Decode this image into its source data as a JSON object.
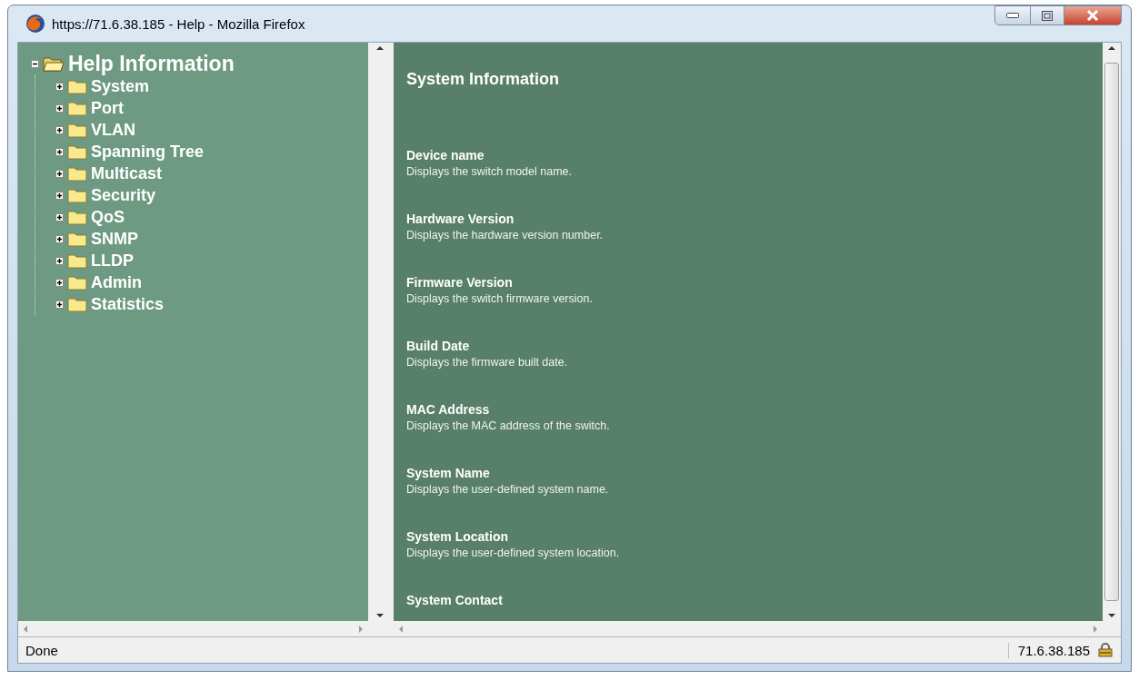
{
  "window": {
    "title": "https://71.6.38.185 - Help - Mozilla Firefox"
  },
  "tree": {
    "label": "Help Information",
    "expanded": true,
    "children": [
      {
        "label": "System",
        "expanded": false
      },
      {
        "label": "Port",
        "expanded": false
      },
      {
        "label": "VLAN",
        "expanded": false
      },
      {
        "label": "Spanning Tree",
        "expanded": false
      },
      {
        "label": "Multicast",
        "expanded": false
      },
      {
        "label": "Security",
        "expanded": false
      },
      {
        "label": "QoS",
        "expanded": false
      },
      {
        "label": "SNMP",
        "expanded": false
      },
      {
        "label": "LLDP",
        "expanded": false
      },
      {
        "label": "Admin",
        "expanded": false
      },
      {
        "label": "Statistics",
        "expanded": false
      }
    ]
  },
  "content": {
    "title": "System Information",
    "entries": [
      {
        "term": "Device name",
        "description": "Displays the switch model name."
      },
      {
        "term": "Hardware Version",
        "description": "Displays the hardware version number."
      },
      {
        "term": "Firmware Version",
        "description": "Displays the switch firmware version."
      },
      {
        "term": "Build Date",
        "description": "Displays the firmware built date."
      },
      {
        "term": "MAC Address",
        "description": "Displays the MAC address of the switch."
      },
      {
        "term": "System Name",
        "description": "Displays the user-defined system name."
      },
      {
        "term": "System Location",
        "description": "Displays the user-defined system location."
      },
      {
        "term": "System Contact"
      }
    ]
  },
  "status_bar": {
    "status": "Done",
    "host": "71.6.38.185"
  }
}
